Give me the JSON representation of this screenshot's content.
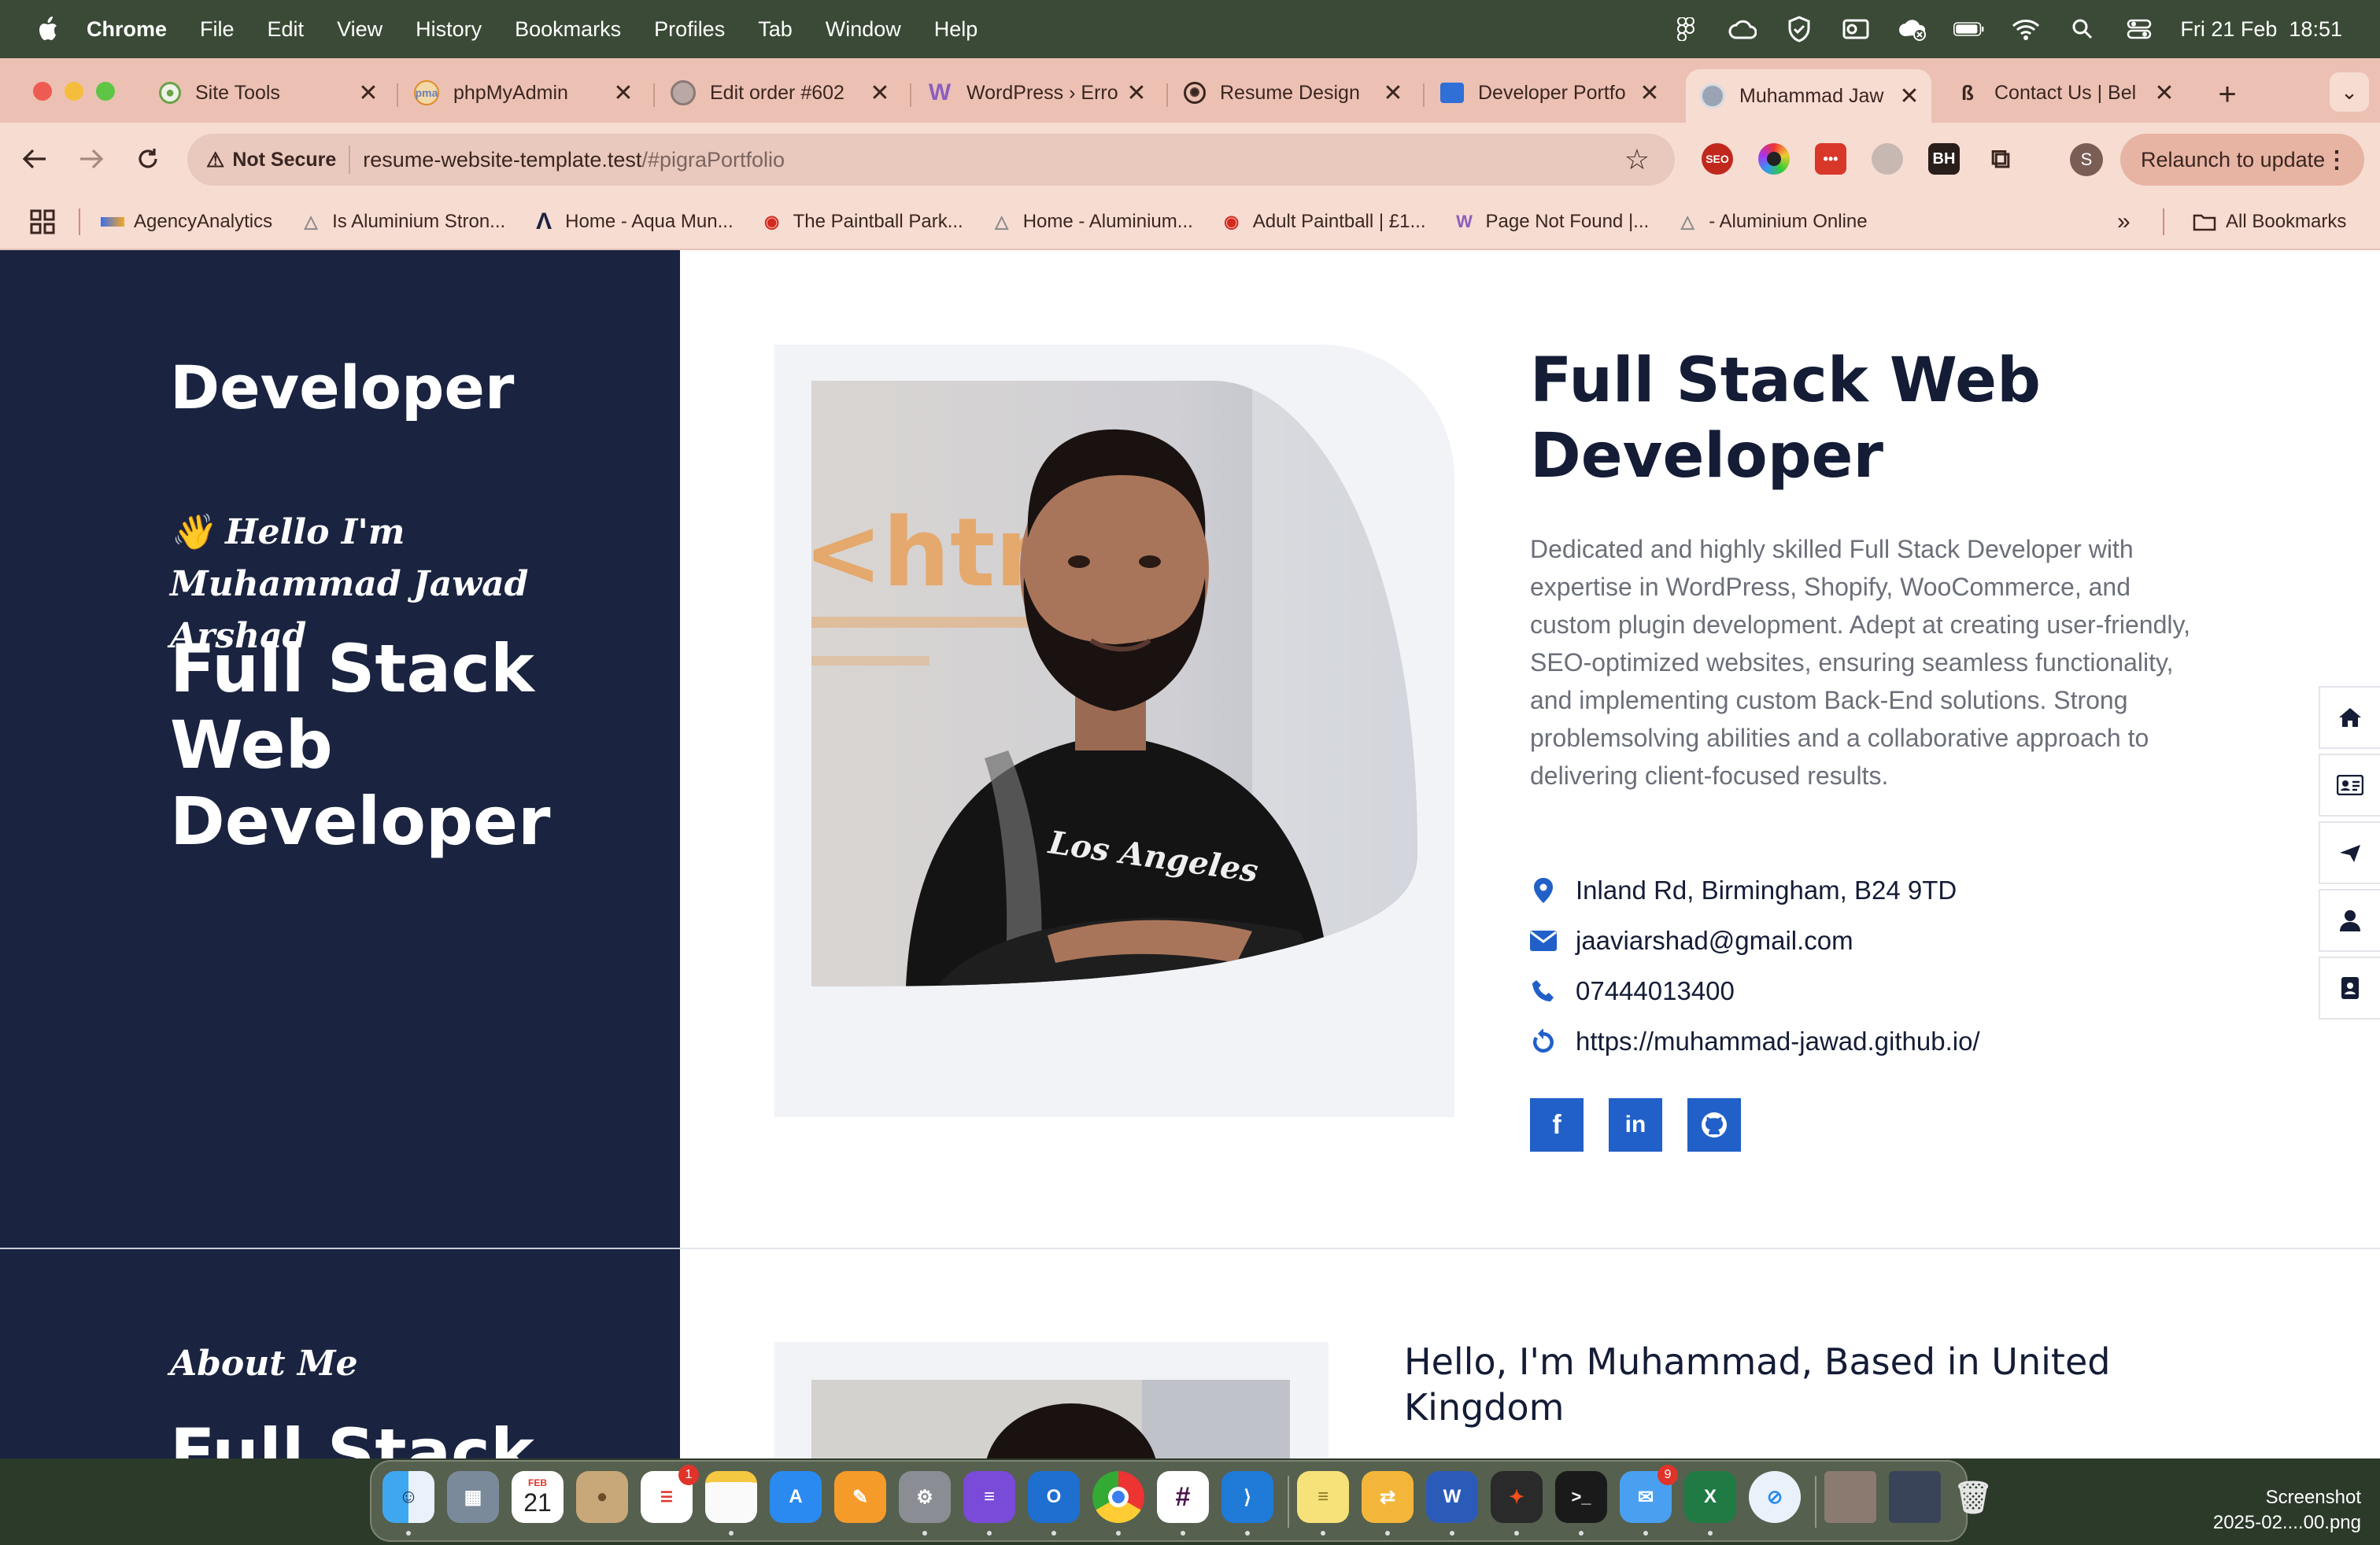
{
  "menubar": {
    "app": "Chrome",
    "items": [
      "File",
      "Edit",
      "View",
      "History",
      "Bookmarks",
      "Profiles",
      "Tab",
      "Window",
      "Help"
    ],
    "datetime": "Fri 21 Feb  18:51"
  },
  "tabs": [
    {
      "title": "Site Tools",
      "icon": "site-tools-icon"
    },
    {
      "title": "phpMyAdmin",
      "icon": "phpmyadmin-icon"
    },
    {
      "title": "Edit order #602",
      "icon": "woo-order-icon"
    },
    {
      "title": "WordPress › Erro",
      "icon": "wordpress-icon"
    },
    {
      "title": "Resume Design",
      "icon": "openai-icon"
    },
    {
      "title": "Developer Portfo",
      "icon": "portfolio-icon"
    },
    {
      "title": "Muhammad Jaw",
      "icon": "globe-icon",
      "active": true
    },
    {
      "title": "Contact Us | Bel",
      "icon": "contact-icon"
    }
  ],
  "toolbar": {
    "security": "Not Secure",
    "url_host": "resume-website-template.test",
    "url_path": "/#pigraPortfolio",
    "profile_initial": "S",
    "relaunch": "Relaunch to update"
  },
  "bookmarks": [
    "AgencyAnalytics",
    "Is Aluminium Stron...",
    "Home - Aqua Mun...",
    "The Paintball Park...",
    "Home - Aluminium...",
    "Adult Paintball | £1...",
    "Page Not Found |...",
    "- Aluminium Online"
  ],
  "bookmarks_all": "All Bookmarks",
  "sidebar": {
    "title": "Developer",
    "hello": "👋 Hello I'm Muhammad Jawad Arshad",
    "role_lines": [
      "Full Stack",
      "Web",
      "Developer"
    ],
    "about": "About Me",
    "role2": "Full Stack"
  },
  "hero": {
    "title_lines": [
      "Full Stack Web",
      "Developer"
    ],
    "description": "Dedicated and highly skilled Full Stack Developer with expertise in WordPress, Shopify, WooCommerce, and custom plugin development. Adept at creating user-friendly, SEO-optimized websites, ensuring seamless functionality, and implementing custom Back-End solutions. Strong problemsolving abilities and a collaborative approach to delivering client-focused results.",
    "contacts": [
      {
        "icon": "location-pin-icon",
        "text": "Inland Rd, Birmingham, B24 9TD"
      },
      {
        "icon": "envelope-icon",
        "text": "jaaviarshad@gmail.com"
      },
      {
        "icon": "phone-icon",
        "text": "07444013400"
      },
      {
        "icon": "link-icon",
        "text": "https://muhammad-jawad.github.io/"
      }
    ],
    "photo_sign_text": "<html",
    "photo_shirt_text": "Los Angeles"
  },
  "about": {
    "heading": "Hello, I'm Muhammad, Based in United Kingdom"
  },
  "dock": {
    "calendar_month": "FEB",
    "calendar_day": "21",
    "reminders_badge": "1",
    "mail_badge": "9"
  },
  "screenshot_label": [
    "Screenshot",
    "2025-02....00.png"
  ],
  "colors": {
    "sidebar_bg": "#1a2340",
    "accent": "#2160c8",
    "heading": "#141c36"
  }
}
